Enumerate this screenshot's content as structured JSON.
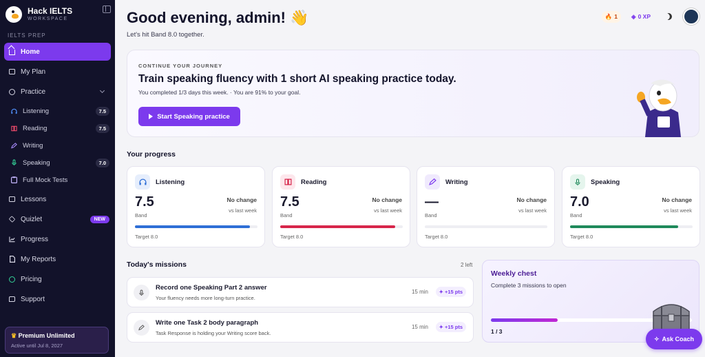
{
  "brand": {
    "name": "Hack IELTS",
    "sub": "WORKSPACE"
  },
  "sidebar": {
    "section_label": "IELTS PREP",
    "items": [
      {
        "label": "Home",
        "active": true
      },
      {
        "label": "My Plan"
      },
      {
        "label": "Practice"
      },
      {
        "label": "Lessons"
      },
      {
        "label": "Quizlet",
        "badge": "NEW"
      },
      {
        "label": "Progress"
      },
      {
        "label": "My Reports"
      },
      {
        "label": "Pricing"
      },
      {
        "label": "Support"
      }
    ],
    "practice_sub": [
      {
        "label": "Listening",
        "score": "7.5"
      },
      {
        "label": "Reading",
        "score": "7.5"
      },
      {
        "label": "Writing"
      },
      {
        "label": "Speaking",
        "score": "7.0"
      },
      {
        "label": "Full Mock Tests"
      }
    ],
    "premium": {
      "title": "Premium Unlimited",
      "sub": "Active until Jul 8, 2027"
    }
  },
  "header": {
    "greeting": "Good evening, admin! 👋",
    "subtitle": "Let's hit Band 8.0 together.",
    "streak": "1",
    "xp": "0 XP"
  },
  "hero": {
    "kicker": "CONTINUE YOUR JOURNEY",
    "title": "Train speaking fluency with 1 short AI speaking practice today.",
    "sub": "You completed 1/3 days this week. · You are 91% to your goal.",
    "button": "Start Speaking practice"
  },
  "progress": {
    "title": "Your progress",
    "cards": [
      {
        "name": "Listening",
        "score": "7.5",
        "band": "Band",
        "change": "No change",
        "vs": "vs last week",
        "target": "Target 8.0",
        "fill": 0.94,
        "color": "#2f6fd6",
        "tint": "#e6eefc"
      },
      {
        "name": "Reading",
        "score": "7.5",
        "band": "Band",
        "change": "No change",
        "vs": "vs last week",
        "target": "Target 8.0",
        "fill": 0.94,
        "color": "#d7264a",
        "tint": "#fde7ec"
      },
      {
        "name": "Writing",
        "score": "—",
        "band": "Band",
        "change": "No change",
        "vs": "vs last week",
        "target": "Target 8.0",
        "fill": 0,
        "color": "#7c3aed",
        "tint": "#f0eafd"
      },
      {
        "name": "Speaking",
        "score": "7.0",
        "band": "Band",
        "change": "No change",
        "vs": "vs last week",
        "target": "Target 8.0",
        "fill": 0.88,
        "color": "#1f8a5b",
        "tint": "#e5f5ed"
      }
    ]
  },
  "missions": {
    "title": "Today's missions",
    "left": "2 left",
    "items": [
      {
        "title": "Record one Speaking Part 2 answer",
        "sub": "Your fluency needs more long-turn practice.",
        "time": "15 min",
        "pts": "+15 pts"
      },
      {
        "title": "Write one Task 2 body paragraph",
        "sub": "Task Response is holding your Writing score back.",
        "time": "15 min",
        "pts": "+15 pts"
      }
    ]
  },
  "chest": {
    "title": "Weekly chest",
    "sub": "Complete 3 missions to open",
    "count": "1 / 3",
    "progress": 0.333
  },
  "coach": {
    "label": "Ask Coach"
  }
}
